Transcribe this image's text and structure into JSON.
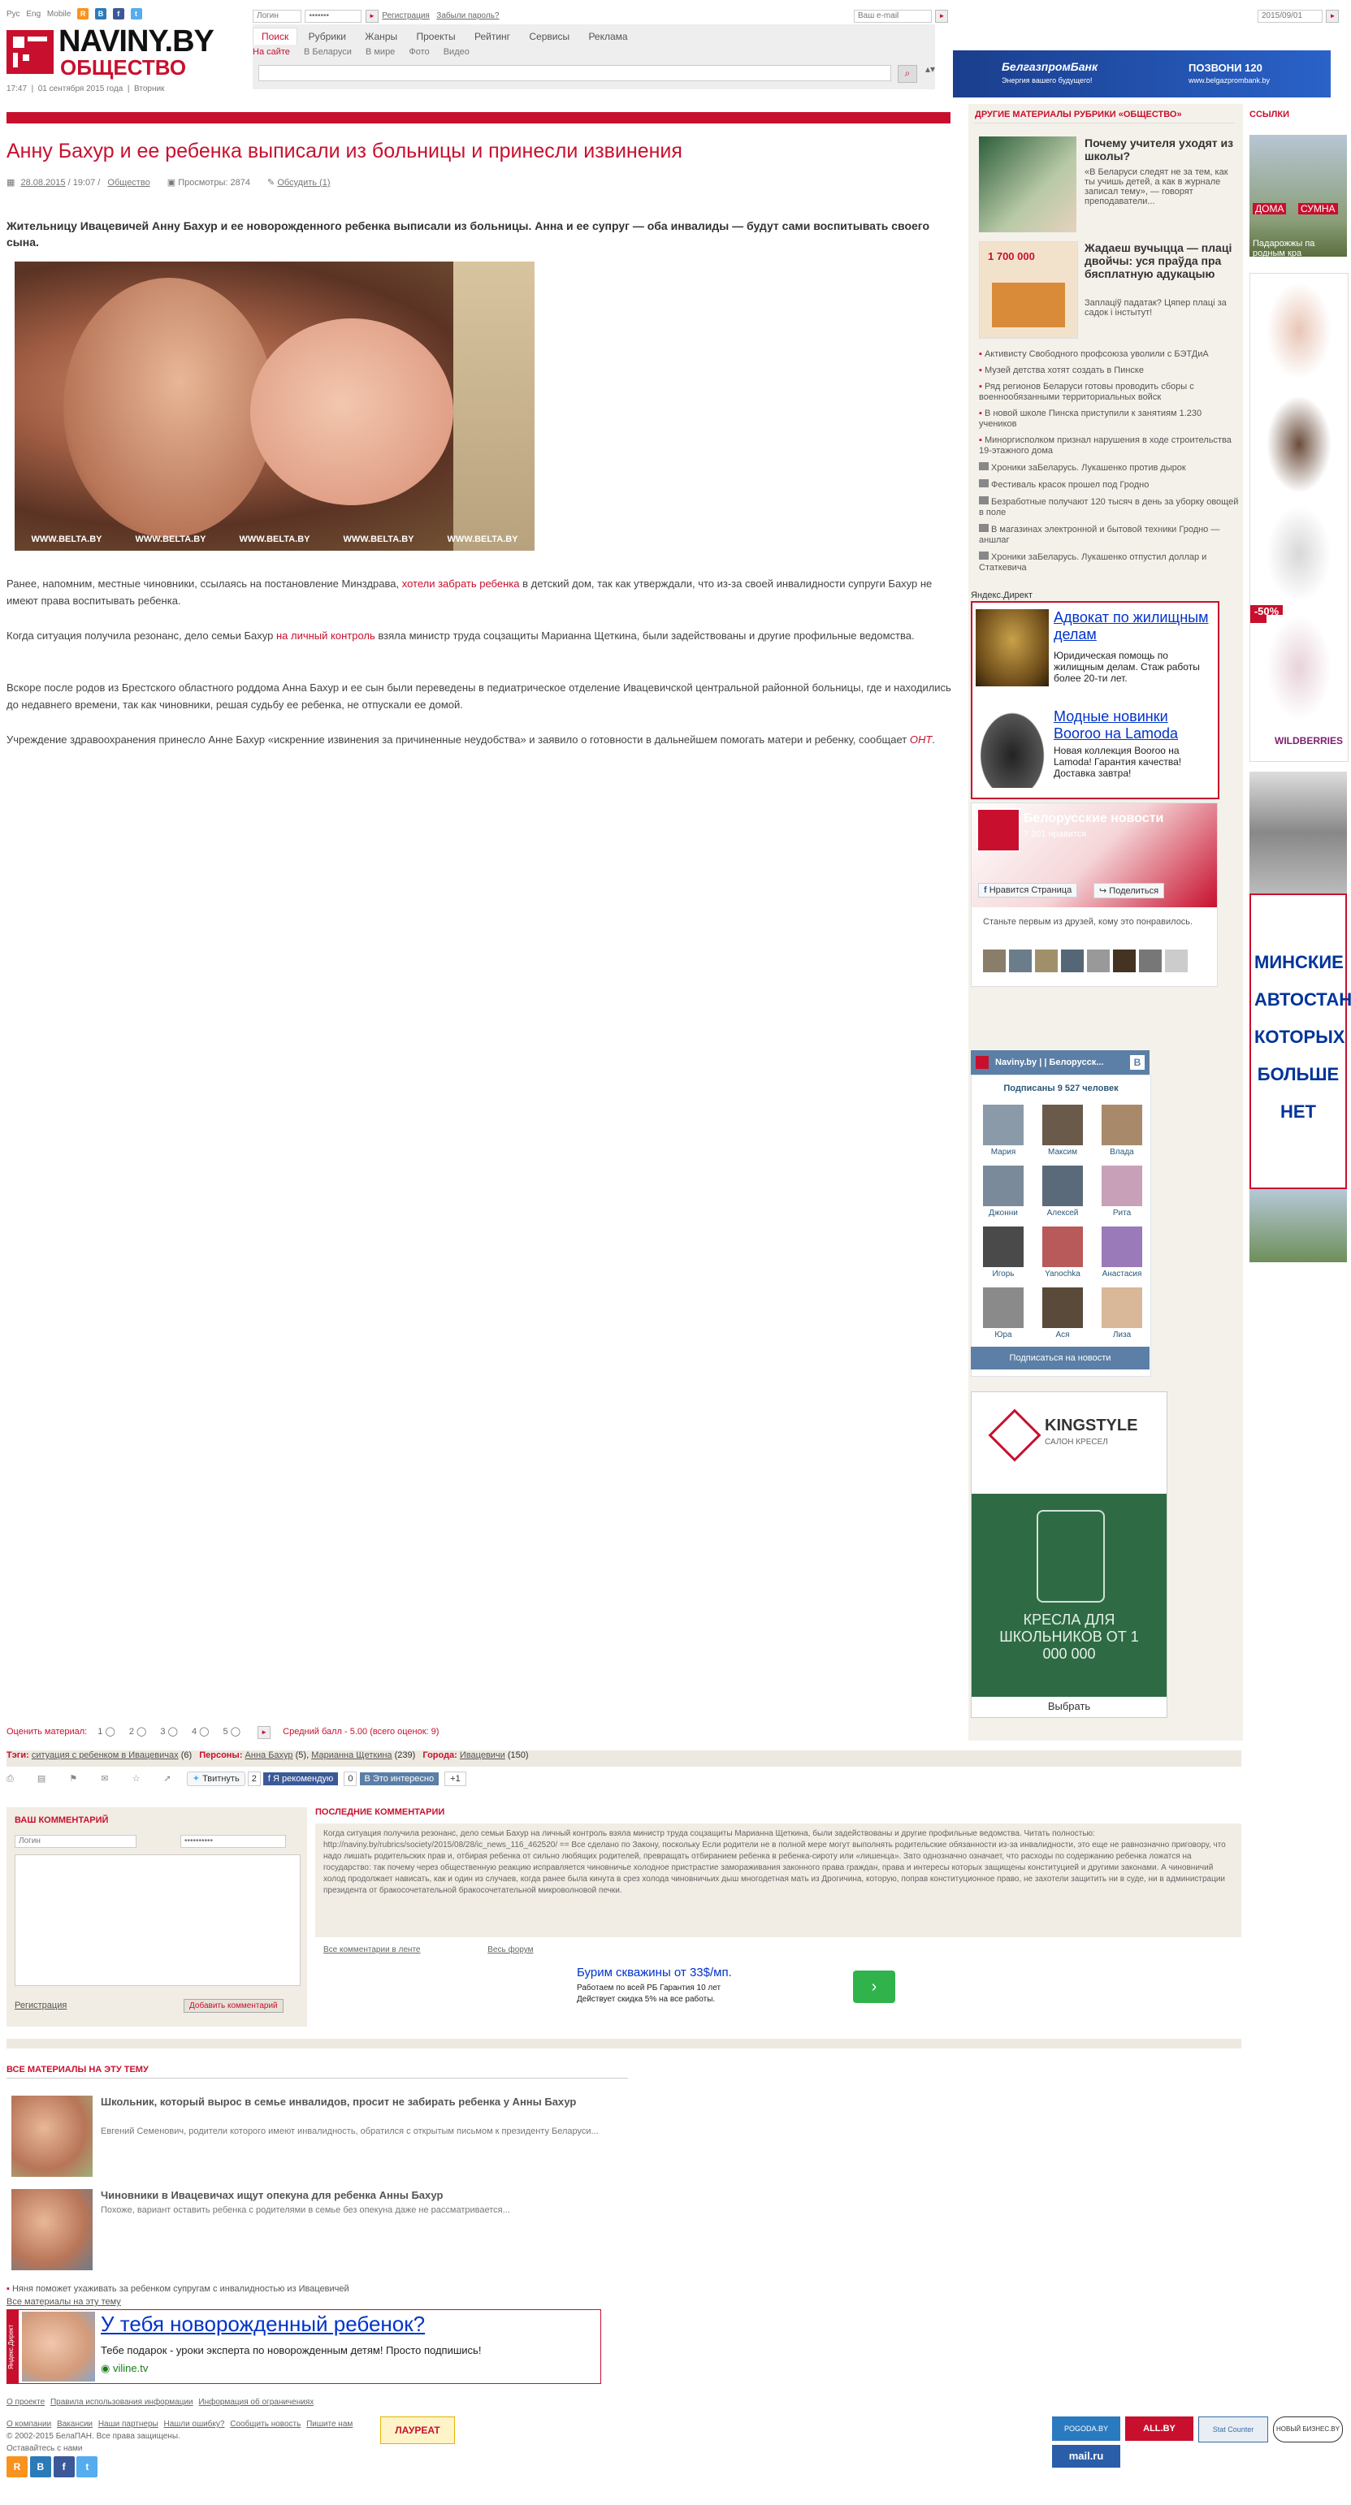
{
  "header": {
    "lang_links": [
      "Рус",
      "Eng",
      "Mobile"
    ],
    "login_placeholder": "Логин",
    "password_placeholder": "•••••••",
    "register_label": "Регистрация",
    "forgot_label": "Забыли пароль?",
    "email_placeholder": "Ваш e-mail",
    "date_field": "2015/09/01",
    "logo_title": "NAVINY.BY",
    "logo_subtitle": "ОБЩЕСТВО",
    "time": "17:47",
    "date": "01 сентября 2015 года",
    "weekday": "Вторник"
  },
  "nav": {
    "main": [
      "Поиск",
      "Рубрики",
      "Жанры",
      "Проекты",
      "Рейтинг",
      "Сервисы",
      "Реклама"
    ],
    "sub": [
      "На сайте",
      "В Беларуси",
      "В мире",
      "Фото",
      "Видео"
    ]
  },
  "top_banner": {
    "brand": "БелгазпромБанк",
    "tagline": "Энергия вашего будущего!",
    "phone": "ПОЗВОНИ 120",
    "url": "www.belgazprombank.by"
  },
  "article": {
    "title": "Анну Бахур и ее ребенка выписали из больницы и принесли извинения",
    "date": "28.08.2015",
    "time": "19:07",
    "rubric": "Общество",
    "views_label": "Просмотры:",
    "views": "2874",
    "discuss_label": "Обсудить (1)",
    "lead": "Жительницу Ивацевичей Анну Бахур и ее новорожденного ребенка выписали из больницы. Анна и ее супруг — оба инвалиды — будут сами воспитывать своего сына.",
    "watermark": "WWW.BELTA.BY",
    "p1_before": "Ранее, напомним, местные чиновники, ссылаясь на постановление Минздрава, ",
    "p1_link": "хотели забрать ребенка",
    "p1_after": " в детский дом, так как утверждали, что из-за своей инвалидности супруги Бахур не имеют права воспитывать ребенка.",
    "p2_before": "Когда ситуация получила резонанс, дело семьи Бахур ",
    "p2_link": "на личный контроль",
    "p2_after": " взяла министр труда соцзащиты Марианна Щеткина, были задействованы и другие профильные ведомства.",
    "p3": "Вскоре после родов из Брестского областного роддома Анна Бахур и ее сын были переведены в педиатрическое отделение Ивацевичской центральной районной больницы, где и находились до недавнего времени, так как чиновники, решая судьбу ее ребенка, не отпускали ее домой.",
    "p4_before": "Учреждение здравоохранения принесло Анне Бахур «искренние извинения за причиненные неудобства» и заявило о готовности в дальнейшем помогать матери и ребенку, сообщает ",
    "p4_link": "ОНТ",
    "p4_after": "."
  },
  "sidebar": {
    "heading": "ДРУГИЕ МАТЕРИАЛЫ РУБРИКИ «ОБЩЕСТВО»",
    "story1_title": "Почему учителя уходят из школы?",
    "story1_desc": "«В Беларуси следят не за тем, как ты учишь детей, а как в журнале записал тему», — говорят преподаватели...",
    "story2_title": "Жадаеш вучыцца — плаці двойчы: уся праўда пра бясплатную адукацыю",
    "story2_desc": "Заплаціў падатак? Цяпер плаці за садок і інстытут!",
    "story2_thumb_text": "1 700 000",
    "news": [
      "Активисту Свободного профсоюза уволили с БЭТДиА",
      "Музей детства хотят создать в Пинске",
      "Ряд регионов Беларуси готовы проводить сборы с военнообязанными территориальных войск",
      "В новой школе Пинска приступили к занятиям 1.230 учеников",
      "Миноргисполком признал нарушения в ходе строительства 19-этажного дома",
      "Хроники заБеларусь. Лукашенко против дырок",
      "Фестиваль красок прошел под Гродно",
      "Безработные получают 120 тысяч в день за уборку овощей в поле",
      "В магазинах электронной и бытовой техники Гродно — аншлаг",
      "Хроники заБеларусь. Лукашенко отпустил доллар и Статкевича"
    ],
    "direct_label": "Яндекс.Директ",
    "ad1_title": "Адвокат по жилищным делам",
    "ad1_desc": "Юридическая помощь по жилищным делам. Стаж работы более 20-ти лет.",
    "ad2_title": "Модные новинки Booroo на Lamoda",
    "ad2_desc": "Новая коллекция Booroo на Lamoda! Гарантия качества! Доставка завтра!",
    "fb_page": "Белорусские новости",
    "fb_likes": "7 201 нравится",
    "fb_like_btn": "Нравится Страница",
    "fb_share_btn": "Поделиться",
    "fb_friends": "Станьте первым из друзей, кому это понравилось.",
    "vk_title": "Naviny.by | | Белорусск...",
    "vk_subs": "Подписаны 9 527 человек",
    "vk_members": [
      "Мария",
      "Максим",
      "Влада",
      "Джонни",
      "Алексей",
      "Рита",
      "Игорь",
      "Yanochka",
      "Анастасия",
      "Юра",
      "Ася",
      "Лиза"
    ],
    "vk_subscribe": "Подписаться на новости",
    "kingstyle_brand": "KINGSTYLE",
    "kingstyle_sub": "САЛОН КРЕСЕЛ",
    "kingstyle_text": "КРЕСЛА ДЛЯ ШКОЛЬНИКОВ ОТ 1 000 000",
    "kingstyle_btn": "Выбрать"
  },
  "right_col": {
    "heading": "ССЫЛКИ",
    "ad1_a": "ДОМА",
    "ad1_b": "СУМНА",
    "ad1_caption": "Падарожжы па родным кра",
    "sale": "-50%",
    "brand": "WILDBERRIES",
    "minsk_text": "МИНСКИЕ АВТОСТАНЦИИ, КОТОРЫХ БОЛЬШЕ НЕТ"
  },
  "rating": {
    "label": "Оценить материал:",
    "options": [
      "1",
      "2",
      "3",
      "4",
      "5"
    ],
    "avg": "Средний балл - 5.00 (всего оценок: 9)"
  },
  "tags": {
    "tags_label": "Тэги:",
    "tag1": "ситуация с ребенком в Ивацевичах",
    "tag1_count": "(6)",
    "persons_label": "Персоны:",
    "person1": "Анна Бахур",
    "person1_count": "(5)",
    "person2": "Марианна Щеткина",
    "person2_count": "(239)",
    "cities_label": "Города:",
    "city1": "Ивацевичи",
    "city1_count": "(150)"
  },
  "share": {
    "tweet": "Твитнуть",
    "tweet_count": "2",
    "fb_recommend": "Я рекомендую",
    "vk_count": "0",
    "interesting": "Это интересно",
    "plus": "+1"
  },
  "comment_form": {
    "heading": "ВАШ КОММЕНТАРИЙ",
    "login_placeholder": "Логин",
    "password_placeholder": "••••••••••",
    "register": "Регистрация",
    "submit": "Добавить комментарий"
  },
  "last_comments": {
    "heading": "ПОСЛЕДНИЕ КОММЕНТАРИИ",
    "text": "Когда ситуация получила резонанс, дело семьи Бахур на личный контроль взяла министр труда соцзащиты Марианна Щеткина, были задействованы и другие профильные ведомства. Читать полностью: http://naviny.by/rubrics/society/2015/08/28/ic_news_116_462520/ == Все сделано по Закону, поскольку Если родители не в полной мере могут выполнять родительские обязанности из-за инвалидности, это еще не равнозначно приговору, что надо лишать родительских прав и, отбирая ребенка от сильно любящих родителей, превращать отбиранием ребенка в ребенка-сироту или «лишенца». Зато однозначно означает, что расходы по содержанию ребенка ложатся на государство: так почему через общественную реакцию исправляется чиновничье холодное пристрастие замораживания законного права граждан, права и интересы которых защищены конституцией и другими законами. А чиновничий холод продолжает нависать, как и один из случаев, когда ранее была кинута в срез холода чиновничьих дыш многодетная мать из Дрогичина, которую, поправ конституционное право, не захотели защитить ни в суде, ни в администрации президента от бракосочетательной бракосочетательной микроволновой печки.",
    "link_feed": "Все комментарии в ленте",
    "link_forum": "Весь форум",
    "ad_title": "Бурим скважины от 33$/мп.",
    "ad_desc1": "Работаем по всей РБ Гарантия 10 лет",
    "ad_desc2": "Действует скидка 5% на все работы."
  },
  "related": {
    "heading": "ВСЕ МАТЕРИАЛЫ НА ЭТУ ТЕМУ",
    "item1_title": "Школьник, который вырос в семье инвалидов, просит не забирать ребенка у Анны Бахур",
    "item1_desc": "Евгений Семенович, родители которого имеют инвалидность, обратился с открытым письмом к президенту Беларуси...",
    "item2_title": "Чиновники в Ивацевичах ищут опекуна для ребенка Анны Бахур",
    "item2_desc": "Похоже, вариант оставить ребенка с родителями в семье без опекуна даже не рассматривается...",
    "extra": "Няня поможет ухаживать за ребенком супругам с инвалидностью из Ивацевичей",
    "all_link": "Все материалы на эту тему"
  },
  "bottom_ad": {
    "side_label": "Яндекс.Директ",
    "title": "У тебя новорожденный ребенок?",
    "desc": "Тебе подарок - уроки эксперта по новорожденным детям! Просто подпишись!",
    "site": "viline.tv"
  },
  "footer": {
    "links1": [
      "О проекте",
      "Правила использования информации",
      "Информация об ограничениях"
    ],
    "links2": [
      "О компании",
      "Вакансии",
      "Наши партнеры",
      "Нашли ошибку?",
      "Сообщить новость",
      "Пишите нам"
    ],
    "copyright": "© 2002-2015 БелаПАН. Все права защищены.",
    "stay": "Оставайтесь с нами",
    "laureat": "ЛАУРЕАТ",
    "counters": [
      "POGODA.BY",
      "ALL.BY",
      "Stat Counter",
      "НОВЫЙ БИЗНЕС.BY",
      "mail.ru"
    ]
  },
  "colors": {
    "brand_red": "#c8102e",
    "sidebar_bg": "#f4f1ea"
  }
}
